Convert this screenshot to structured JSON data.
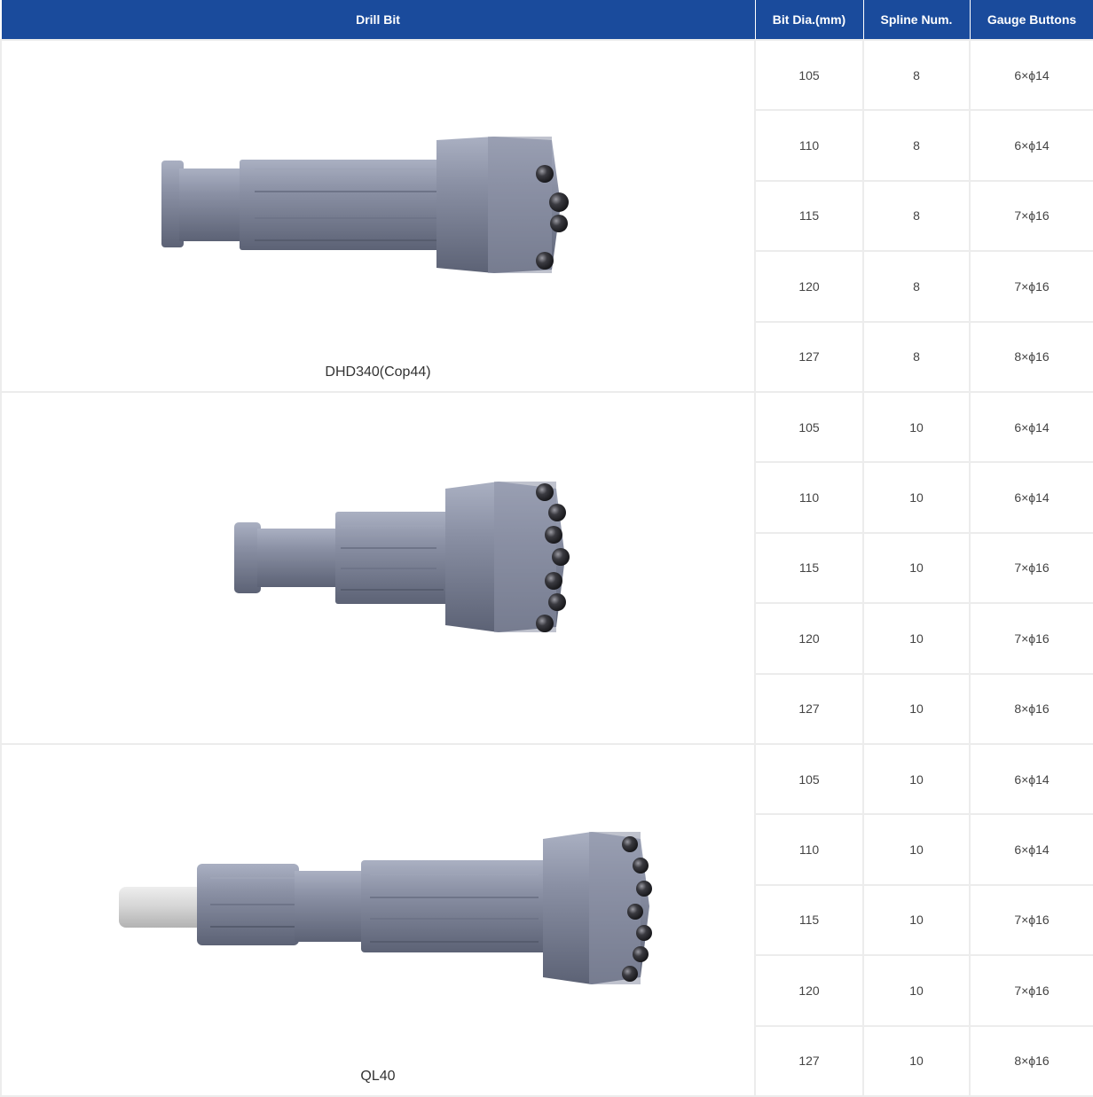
{
  "header": {
    "drill_bit": "Drill Bit",
    "bit_dia": "Bit Dia.(mm)",
    "spline_num": "Spline Num.",
    "gauge_buttons": "Gauge Buttons"
  },
  "groups": [
    {
      "model": "DHD340(Cop44)",
      "image_icon": "drill-bit-dhd340-image",
      "rows": [
        {
          "dia": "105",
          "spline": "8",
          "gauge": "6×ϕ14"
        },
        {
          "dia": "110",
          "spline": "8",
          "gauge": "6×ϕ14"
        },
        {
          "dia": "115",
          "spline": "8",
          "gauge": "7×ϕ16"
        },
        {
          "dia": "120",
          "spline": "8",
          "gauge": "7×ϕ16"
        },
        {
          "dia": "127",
          "spline": "8",
          "gauge": "8×ϕ16"
        }
      ]
    },
    {
      "model": "",
      "image_icon": "drill-bit-image",
      "rows": [
        {
          "dia": "105",
          "spline": "10",
          "gauge": "6×ϕ14"
        },
        {
          "dia": "110",
          "spline": "10",
          "gauge": "6×ϕ14"
        },
        {
          "dia": "115",
          "spline": "10",
          "gauge": "7×ϕ16"
        },
        {
          "dia": "120",
          "spline": "10",
          "gauge": "7×ϕ16"
        },
        {
          "dia": "127",
          "spline": "10",
          "gauge": "8×ϕ16"
        }
      ]
    },
    {
      "model": "QL40",
      "image_icon": "drill-bit-ql40-image",
      "rows": [
        {
          "dia": "105",
          "spline": "10",
          "gauge": "6×ϕ14"
        },
        {
          "dia": "110",
          "spline": "10",
          "gauge": "6×ϕ14"
        },
        {
          "dia": "115",
          "spline": "10",
          "gauge": "7×ϕ16"
        },
        {
          "dia": "120",
          "spline": "10",
          "gauge": "7×ϕ16"
        },
        {
          "dia": "127",
          "spline": "10",
          "gauge": "8×ϕ16"
        }
      ]
    }
  ],
  "colors": {
    "header_bg": "#1a4b9c",
    "header_text": "#ffffff",
    "cell_border": "#ececec",
    "bit_metal": "#7e8498",
    "bit_metal_dark": "#5c6275",
    "carbide_button": "#2a2a2e"
  }
}
